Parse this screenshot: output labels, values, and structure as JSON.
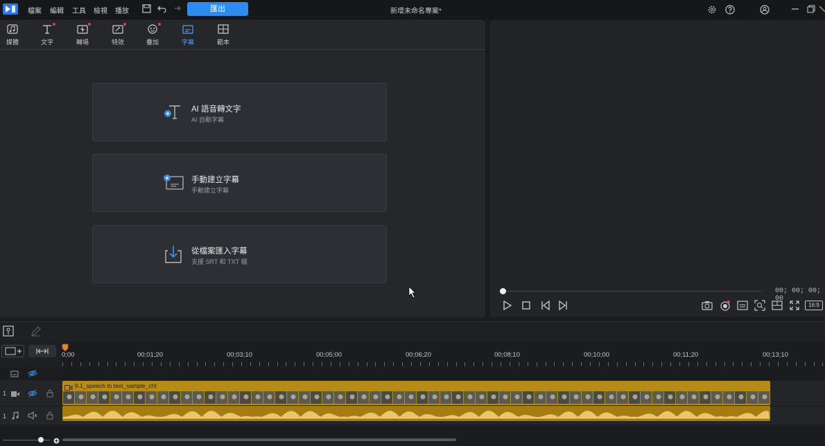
{
  "app": {
    "menu": [
      "檔案",
      "編輯",
      "工具",
      "檢視",
      "播放"
    ],
    "export_label": "匯出",
    "project_title": "新增未命名專案*"
  },
  "library": {
    "tabs": [
      {
        "label": "媒體",
        "icon": "media-icon"
      },
      {
        "label": "文字",
        "icon": "text-icon"
      },
      {
        "label": "轉場",
        "icon": "transition-icon"
      },
      {
        "label": "特效",
        "icon": "effects-icon"
      },
      {
        "label": "疊加",
        "icon": "overlay-icon"
      },
      {
        "label": "字幕",
        "icon": "subtitle-icon"
      },
      {
        "label": "範本",
        "icon": "template-icon"
      }
    ],
    "active_tab": "字幕",
    "cards": [
      {
        "title": "AI 語音轉文字",
        "subtitle": "AI 自動字幕",
        "icon": "ai-speech-to-text-icon"
      },
      {
        "title": "手動建立字幕",
        "subtitle": "手動建立字幕",
        "icon": "manual-subtitle-icon"
      },
      {
        "title": "從檔案匯入字幕",
        "subtitle": "支援 SRT 和 TXT 檔",
        "icon": "import-file-icon"
      }
    ]
  },
  "preview": {
    "timecode": "00; 00; 00; 00",
    "aspect_ratio": "16:9"
  },
  "timeline": {
    "ruler_labels": [
      "0;00",
      "00;01;20",
      "00;03;10",
      "00;05;00",
      "00;06;20",
      "00;08;10",
      "00;10;00",
      "00;11;20",
      "00;13;10"
    ],
    "tracks": [
      {
        "number": "1",
        "type": "video"
      },
      {
        "number": "1",
        "type": "audio"
      }
    ],
    "clip_name": "9.1_speech to text_sample_cht"
  },
  "colors": {
    "accent": "#2d8cf0",
    "clip": "#b88a18",
    "panel": "#26272b"
  }
}
